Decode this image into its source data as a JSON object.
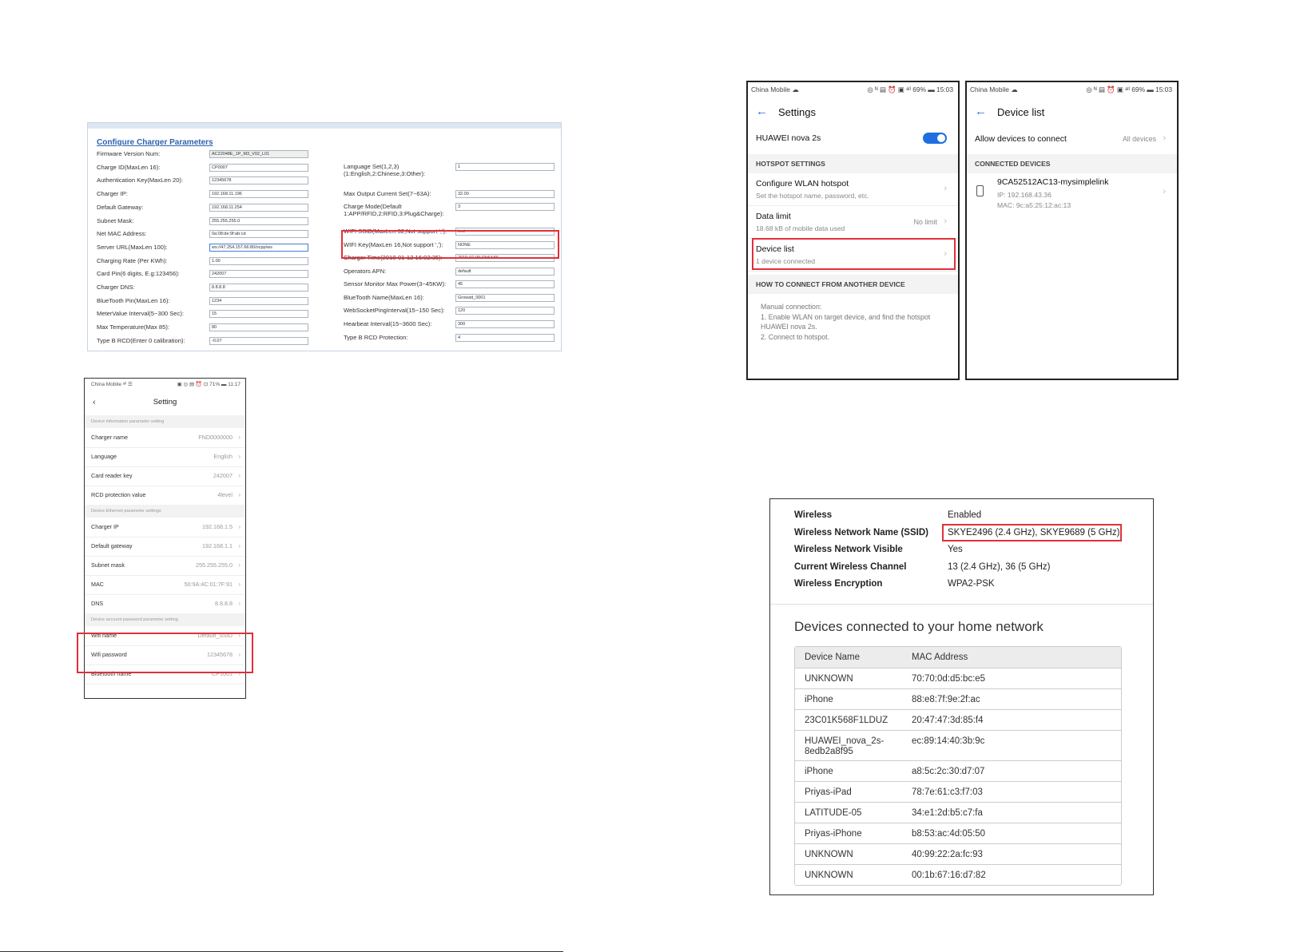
{
  "config_panel": {
    "title": "Configure Charger Parameters",
    "left_fields": [
      {
        "label": "Firmware Version Num:",
        "value": "AC22048E_1P_M3_V02_L01",
        "readonly": true
      },
      {
        "label": "Charge ID(MaxLen 16):",
        "value": "CP0007"
      },
      {
        "label": "Authentication Key(MaxLen 20):",
        "value": "12345678"
      },
      {
        "label": "Charger IP:",
        "value": "192.168.11.196"
      },
      {
        "label": "Default Gateway:",
        "value": "192.168.11.254"
      },
      {
        "label": "Subnet Mask:",
        "value": "255.255.255.0"
      },
      {
        "label": "Net MAC Address:",
        "value": "0a:08:de:9f:ab:cd"
      },
      {
        "label": "Server URL(MaxLen 100):",
        "value": "ws://47.254.157.66:80/ocpp/ws",
        "selected": true
      },
      {
        "label": "Charging Rate (Per KWh):",
        "value": "1.00"
      },
      {
        "label": "Card Pin(6 digits, E.g:123456):",
        "value": "242007"
      },
      {
        "label": "Charger DNS:",
        "value": "8.8.8.8"
      },
      {
        "label": "BlueTooth Pin(MaxLen 16):",
        "value": "1234"
      },
      {
        "label": "MeterValue Interval(5~300 Sec):",
        "value": "15"
      },
      {
        "label": "Max Temperature(Max 85):",
        "value": "80"
      },
      {
        "label": "Type B RCD(Enter 0 calibration):",
        "value": "-0.07"
      }
    ],
    "right_fields": [
      {
        "label": "Language Set(1,2,3)",
        "label2": "(1:English,2:Chinese,3:Other):",
        "value": "1"
      },
      {
        "label": "Max Output Current Set(7~63A):",
        "value": "32.00"
      },
      {
        "label": "Charge Mode(Default",
        "label2": "1:APP/RFID,2:RFID,3:Plug&Charge):",
        "value": "3"
      },
      {
        "label": "WIFI SSID(MaxLen 32,Not support ','):",
        "value": "test"
      },
      {
        "label": "WIFI Key(MaxLen 16,Not support ','):",
        "value": "NONE"
      },
      {
        "label": "Charger Time(2018-01-12 16:02:35):",
        "value": "2019-07-09 03:54:56"
      },
      {
        "label": "Operators APN:",
        "value": "default"
      },
      {
        "label": "Sensor Monitor Max Power(3~45KW):",
        "value": "45"
      },
      {
        "label": "BlueTooth Name(MaxLen 16):",
        "value": "Growatt_0001"
      },
      {
        "label": "WebSocketPingInterval(15~150 Sec):",
        "value": "120"
      },
      {
        "label": "Hearbeat Interval(15~3600 Sec):",
        "value": "300"
      },
      {
        "label": "Type B RCD Protection:",
        "value": "4"
      }
    ]
  },
  "app_setting": {
    "status_left": "China Mobile ᵃˡˡ ☰",
    "status_right": "▣ ◎ ▤ ⏰ ⊡ 71% ▬ 11:17",
    "back": "‹",
    "title": "Setting",
    "sections": [
      "Device information parameter setting",
      "Device Ethernet parameter settings",
      "Device account password parameter setting"
    ],
    "items": [
      {
        "label": "Charger name",
        "value": "FND0000000"
      },
      {
        "label": "Language",
        "value": "English"
      },
      {
        "label": "Card reader key",
        "value": "242007"
      },
      {
        "label": "RCD protection value",
        "value": "4level"
      },
      {
        "label": "Charger IP",
        "value": "192.168.1.5"
      },
      {
        "label": "Default gateway",
        "value": "192.168.1.1"
      },
      {
        "label": "Subnet mask",
        "value": "255.255.255.0"
      },
      {
        "label": "MAC",
        "value": "50:9A:4C:01:7F:91"
      },
      {
        "label": "DNS",
        "value": "8.8.8.8"
      },
      {
        "label": "Wifi name",
        "value": "Default_SSID"
      },
      {
        "label": "Wifi password",
        "value": "12345678"
      },
      {
        "label": "Bluetooth name",
        "value": "CP1001"
      }
    ]
  },
  "hotspot": {
    "status_left": "China Mobile ☁",
    "status_right": "◎ ᴺ ▤ ⏰ ▣ ᵃˡˡ 69% ▬ 15:03",
    "title": "Settings",
    "device_name": "HUAWEI nova 2s",
    "section_hotspot": "HOTSPOT SETTINGS",
    "configure_title": "Configure WLAN hotspot",
    "configure_sub": "Set the hotspot name, password, etc.",
    "data_limit_title": "Data limit",
    "data_limit_sub": "18.68 kB of mobile data used",
    "data_limit_value": "No limit",
    "device_list_title": "Device list",
    "device_list_sub": "1 device connected",
    "section_connect": "HOW TO CONNECT FROM ANOTHER DEVICE",
    "connect_lines": [
      "Manual connection:",
      "1. Enable WLAN on target device, and find the hotspot",
      "HUAWEI nova 2s.",
      "2. Connect to hotspot."
    ]
  },
  "device_list": {
    "status_left": "China Mobile ☁",
    "status_right": "◎ ᴺ ▤ ⏰ ▣ ᵃˡˡ 69% ▬ 15:03",
    "title": "Device list",
    "allow_label": "Allow devices to connect",
    "allow_value": "All devices",
    "section_connected": "CONNECTED DEVICES",
    "device_name": "9CA52512AC13-mysimplelink",
    "device_ip": "IP: 192.168.43.36",
    "device_mac": "MAC: 9c:a5:25:12:ac:13"
  },
  "router": {
    "info": [
      {
        "key": "Wireless",
        "value": "Enabled"
      },
      {
        "key": "Wireless Network Name (SSID)",
        "value": "SKYE2496 (2.4 GHz), SKYE9689 (5 GHz)"
      },
      {
        "key": "Wireless Network Visible",
        "value": "Yes"
      },
      {
        "key": "Current Wireless Channel",
        "value": "13 (2.4 GHz), 36 (5 GHz)"
      },
      {
        "key": "Wireless Encryption",
        "value": "WPA2-PSK"
      }
    ],
    "devices_heading": "Devices connected to your home network",
    "col_name": "Device Name",
    "col_mac": "MAC Address",
    "devices": [
      {
        "name": "UNKNOWN",
        "mac": "70:70:0d:d5:bc:e5"
      },
      {
        "name": "iPhone",
        "mac": "88:e8:7f:9e:2f:ac"
      },
      {
        "name": "23C01K568F1LDUZ",
        "mac": "20:47:47:3d:85:f4"
      },
      {
        "name": "HUAWEI_nova_2s-8edb2a8f95",
        "mac": "ec:89:14:40:3b:9c"
      },
      {
        "name": "iPhone",
        "mac": "a8:5c:2c:30:d7:07"
      },
      {
        "name": "Priyas-iPad",
        "mac": "78:7e:61:c3:f7:03"
      },
      {
        "name": "LATITUDE-05",
        "mac": "34:e1:2d:b5:c7:fa"
      },
      {
        "name": "Priyas-iPhone",
        "mac": "b8:53:ac:4d:05:50"
      },
      {
        "name": "UNKNOWN",
        "mac": "40:99:22:2a:fc:93"
      },
      {
        "name": "UNKNOWN",
        "mac": "00:1b:67:16:d7:82"
      }
    ]
  },
  "colors": {
    "highlight": "#e0303a",
    "accent_blue": "#1f6fe0",
    "link_blue": "#2f62b0"
  }
}
